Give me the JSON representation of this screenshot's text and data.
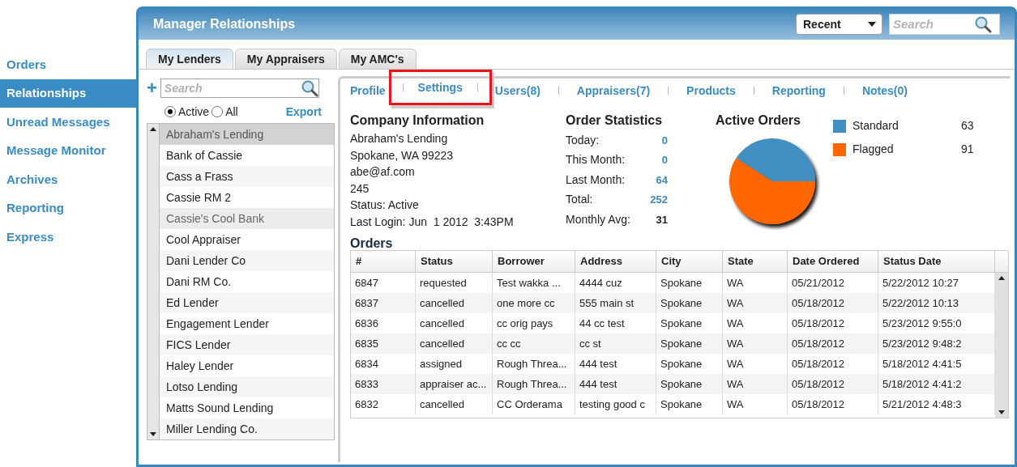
{
  "nav": [
    {
      "label": "Orders",
      "selected": false
    },
    {
      "label": "Relationships",
      "selected": true
    },
    {
      "label": "Unread Messages",
      "selected": false
    },
    {
      "label": "Message Monitor",
      "selected": false
    },
    {
      "label": "Archives",
      "selected": false
    },
    {
      "label": "Reporting",
      "selected": false
    },
    {
      "label": "Express",
      "selected": false
    }
  ],
  "window": {
    "title": "Manager Relationships",
    "recent": "Recent",
    "search_placeholder": "Search"
  },
  "tabs": [
    {
      "label": "My Lenders",
      "selected": true
    },
    {
      "label": "My Appraisers",
      "selected": false
    },
    {
      "label": "My AMC's",
      "selected": false
    }
  ],
  "list_panel": {
    "add": "+",
    "search_placeholder": "Search",
    "filters": [
      {
        "label": "Active",
        "selected": true
      },
      {
        "label": "All",
        "selected": false
      }
    ],
    "export": "Export",
    "items": [
      {
        "label": "Abraham's Lending",
        "selected": true,
        "hovered": false
      },
      {
        "label": "Bank of Cassie",
        "selected": false,
        "hovered": false
      },
      {
        "label": "Cass a Frass",
        "selected": false,
        "hovered": false
      },
      {
        "label": "Cassie RM 2",
        "selected": false,
        "hovered": false
      },
      {
        "label": "Cassie's Cool Bank",
        "selected": false,
        "hovered": true
      },
      {
        "label": "Cool Appraiser",
        "selected": false,
        "hovered": false
      },
      {
        "label": "Dani Lender Co",
        "selected": false,
        "hovered": false
      },
      {
        "label": "Dani RM Co.",
        "selected": false,
        "hovered": false
      },
      {
        "label": "Ed Lender",
        "selected": false,
        "hovered": false
      },
      {
        "label": "Engagement Lender",
        "selected": false,
        "hovered": false
      },
      {
        "label": "FICS Lender",
        "selected": false,
        "hovered": false
      },
      {
        "label": "Haley Lender",
        "selected": false,
        "hovered": false
      },
      {
        "label": "Lotso Lending",
        "selected": false,
        "hovered": false
      },
      {
        "label": "Matts Sound Lending",
        "selected": false,
        "hovered": false
      },
      {
        "label": "Miller Lending Co.",
        "selected": false,
        "hovered": false
      }
    ]
  },
  "detail_links": [
    "Profile",
    "Settings",
    "Users(8)",
    "Appraisers(7)",
    "Products",
    "Reporting",
    "Notes(0)"
  ],
  "company": {
    "title": "Company Information",
    "lines": [
      "Abraham's Lending",
      "Spokane, WA 99223",
      "abe@af.com",
      "245",
      "Status: Active",
      "Last Login: Jun  1 2012  3:43PM"
    ]
  },
  "statistics": {
    "title": "Order Statistics",
    "rows": [
      {
        "label": "Today:",
        "value": "0",
        "kind": "link"
      },
      {
        "label": "This Month:",
        "value": "0",
        "kind": "link"
      },
      {
        "label": "Last Month:",
        "value": "64",
        "kind": "link"
      },
      {
        "label": "Total:",
        "value": "252",
        "kind": "link"
      },
      {
        "label": "Monthly Avg:",
        "value": "31",
        "kind": "plain"
      }
    ]
  },
  "active_orders": {
    "chart_data": {
      "type": "pie",
      "title": "Active Orders",
      "series": [
        {
          "values": [
            40.9,
            59.1
          ]
        }
      ],
      "colors": [
        "#428fc1",
        "#ff6600"
      ]
    },
    "legend": [
      {
        "label": "Standard",
        "value": "63",
        "color": "#428fc1"
      },
      {
        "label": "Flagged",
        "value": "91",
        "color": "#ff6600"
      }
    ]
  },
  "orders": {
    "title": "Orders",
    "columns": [
      "#",
      "Status",
      "Borrower",
      "Address",
      "City",
      "State",
      "Date Ordered",
      "Status Date"
    ],
    "rows": [
      [
        "6847",
        "requested",
        "Test wakka ...",
        "4444 cuz",
        "Spokane",
        "WA",
        "05/21/2012",
        "5/22/2012 10:27"
      ],
      [
        "6837",
        "cancelled",
        "one more cc",
        "555 main st",
        "Spokane",
        "WA",
        "05/18/2012",
        "5/22/2012 10:13"
      ],
      [
        "6836",
        "cancelled",
        "cc orig pays",
        "44 cc test",
        "Spokane",
        "WA",
        "05/18/2012",
        "5/23/2012 9:55:0"
      ],
      [
        "6835",
        "cancelled",
        "cc cc",
        "cc st",
        "Spokane",
        "WA",
        "05/18/2012",
        "5/23/2012 9:48:2"
      ],
      [
        "6834",
        "assigned",
        "Rough Threa...",
        "444 test",
        "Spokane",
        "WA",
        "05/18/2012",
        "5/18/2012 4:41:5"
      ],
      [
        "6833",
        "appraiser ac...",
        "Rough Threa...",
        "444 test",
        "Spokane",
        "WA",
        "05/18/2012",
        "5/18/2012 4:41:2"
      ],
      [
        "6832",
        "cancelled",
        "CC Orderama",
        "testing good c",
        "Spokane",
        "WA",
        "05/18/2012",
        "5/21/2012 4:48:3"
      ]
    ]
  }
}
